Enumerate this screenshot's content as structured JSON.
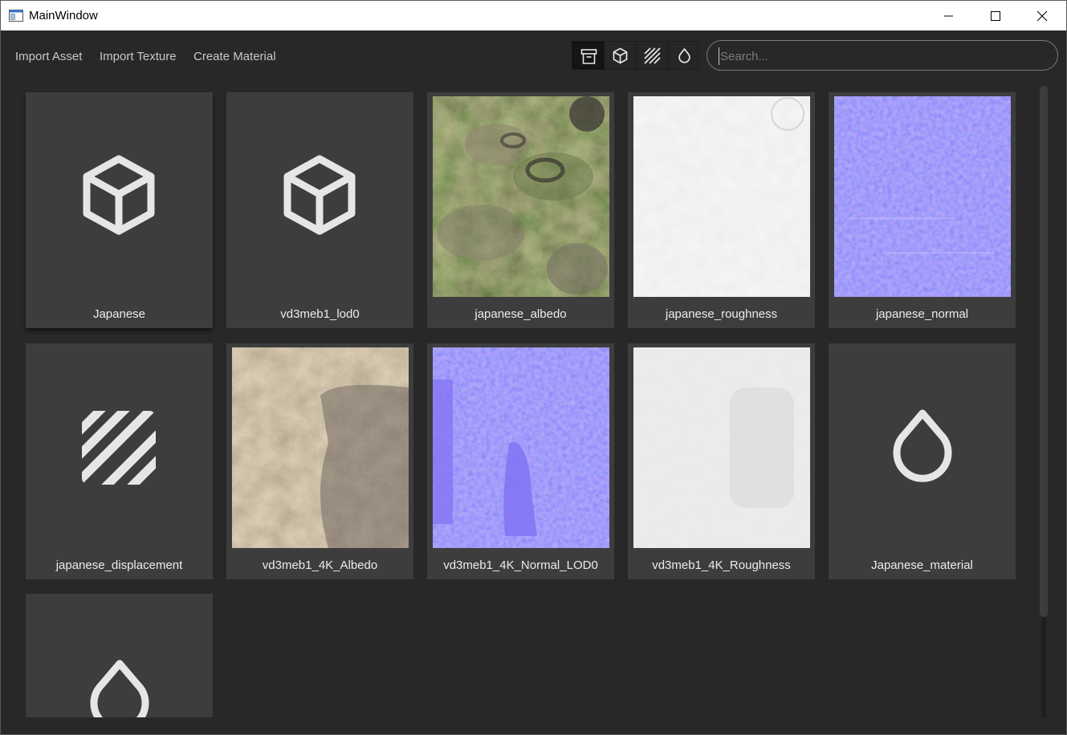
{
  "window": {
    "title": "MainWindow"
  },
  "menu": {
    "import_asset": "Import Asset",
    "import_texture": "Import Texture",
    "create_material": "Create Material"
  },
  "filters": [
    {
      "icon": "archive-icon",
      "active": true
    },
    {
      "icon": "cube-icon",
      "active": false
    },
    {
      "icon": "texture-stripes-icon",
      "active": false
    },
    {
      "icon": "material-drop-icon",
      "active": false
    }
  ],
  "search": {
    "placeholder": "Search...",
    "value": ""
  },
  "assets": [
    {
      "label": "Japanese",
      "kind": "model",
      "icon": "cube-icon"
    },
    {
      "label": "vd3meb1_lod0",
      "kind": "model",
      "icon": "cube-icon"
    },
    {
      "label": "japanese_albedo",
      "kind": "texture",
      "preview": "albedo-green-brown"
    },
    {
      "label": "japanese_roughness",
      "kind": "texture",
      "preview": "light-grey"
    },
    {
      "label": "japanese_normal",
      "kind": "texture",
      "preview": "normal-map-blue"
    },
    {
      "label": "japanese_displacement",
      "kind": "texture",
      "icon": "texture-stripes-icon"
    },
    {
      "label": "vd3meb1_4K_Albedo",
      "kind": "texture",
      "preview": "albedo-sand"
    },
    {
      "label": "vd3meb1_4K_Normal_LOD0",
      "kind": "texture",
      "preview": "normal-map-blue"
    },
    {
      "label": "vd3meb1_4K_Roughness",
      "kind": "texture",
      "preview": "light-grey"
    },
    {
      "label": "Japanese_material",
      "kind": "material",
      "icon": "material-drop-icon"
    },
    {
      "label": "",
      "kind": "material",
      "icon": "material-drop-icon"
    }
  ],
  "colors": {
    "background": "#282828",
    "card": "#3d3d3d",
    "text": "#ececec",
    "normal_map": "#8476f4",
    "roughness": "#e6e6e6"
  }
}
